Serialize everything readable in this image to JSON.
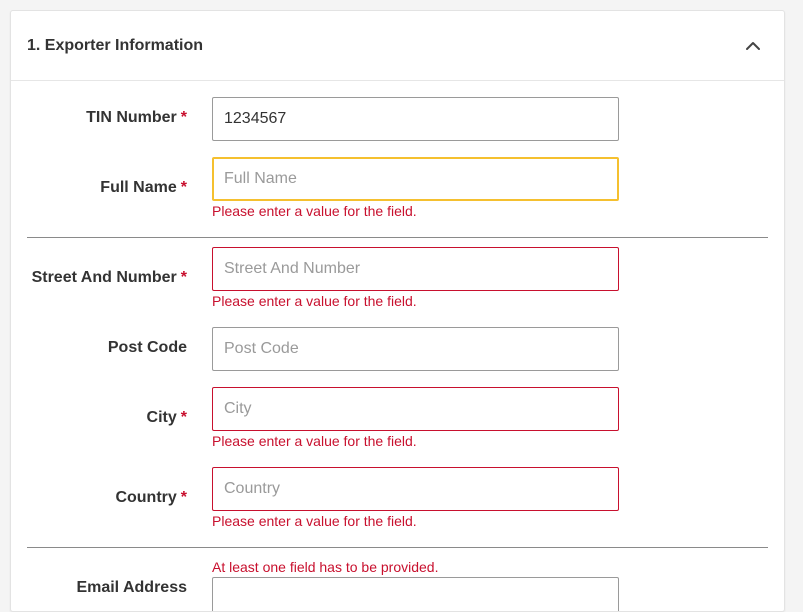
{
  "section": {
    "title": "1. Exporter Information"
  },
  "required_marker": "*",
  "fields": {
    "tin": {
      "label": "TIN Number",
      "value": "1234567"
    },
    "full_name": {
      "label": "Full Name",
      "placeholder": "Full Name",
      "error": "Please enter a value for the field."
    },
    "street": {
      "label": "Street And Number",
      "placeholder": "Street And Number",
      "error": "Please enter a value for the field."
    },
    "post_code": {
      "label": "Post Code",
      "placeholder": "Post Code"
    },
    "city": {
      "label": "City",
      "placeholder": "City",
      "error": "Please enter a value for the field."
    },
    "country": {
      "label": "Country",
      "placeholder": "Country",
      "error": "Please enter a value for the field."
    },
    "email": {
      "label": "Email Address",
      "group_error": "At least one field has to be provided."
    }
  },
  "colors": {
    "error": "#c8102e",
    "focus": "#f5c02f",
    "border": "#9a9a9a",
    "text": "#333333"
  },
  "icons": {
    "collapse": "chevron-up-icon"
  }
}
